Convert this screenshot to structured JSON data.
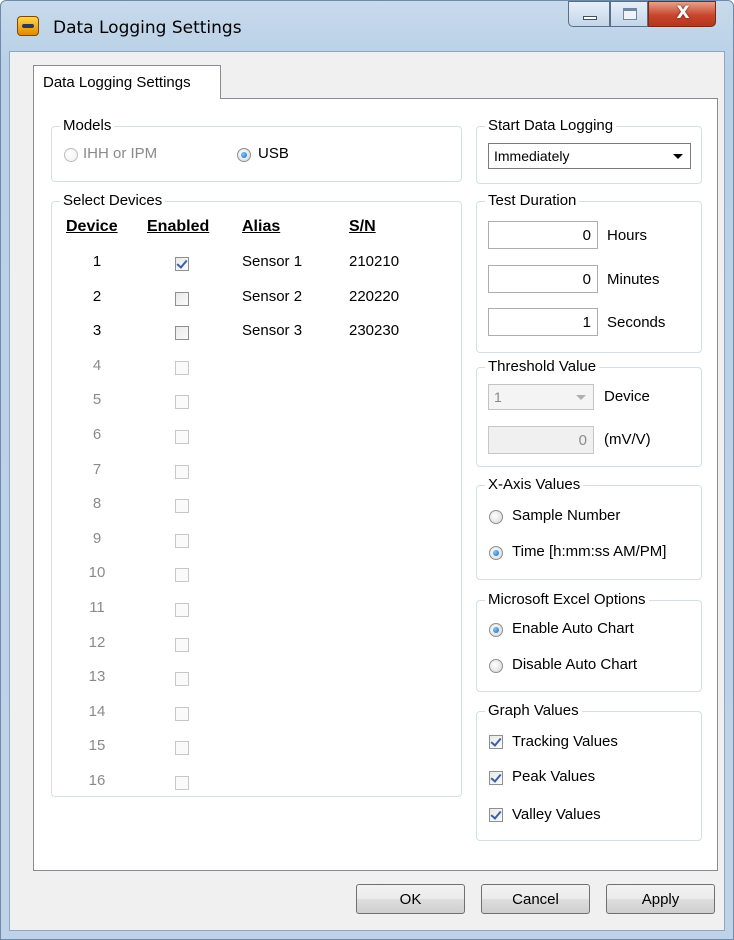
{
  "window": {
    "title": "Data Logging Settings",
    "close_glyph": "X",
    "icons": {
      "app": "usb-app-icon",
      "min": "minimize-icon",
      "max": "maximize-icon",
      "close": "close-icon"
    }
  },
  "tab": {
    "label": "Data Logging Settings"
  },
  "models": {
    "label": "Models",
    "options": [
      {
        "label": "IHH or IPM",
        "checked": false,
        "enabled": false
      },
      {
        "label": "USB",
        "checked": true,
        "enabled": true
      }
    ]
  },
  "devices": {
    "label": "Select Devices",
    "headers": {
      "device": "Device",
      "enabled": "Enabled",
      "alias": "Alias",
      "sn": "S/N"
    },
    "rows": [
      {
        "device": "1",
        "enabled": true,
        "active": true,
        "alias": "Sensor 1",
        "sn": "210210"
      },
      {
        "device": "2",
        "enabled": false,
        "active": true,
        "alias": "Sensor 2",
        "sn": "220220"
      },
      {
        "device": "3",
        "enabled": false,
        "active": true,
        "alias": "Sensor 3",
        "sn": "230230"
      },
      {
        "device": "4",
        "enabled": false,
        "active": false,
        "alias": "",
        "sn": ""
      },
      {
        "device": "5",
        "enabled": false,
        "active": false,
        "alias": "",
        "sn": ""
      },
      {
        "device": "6",
        "enabled": false,
        "active": false,
        "alias": "",
        "sn": ""
      },
      {
        "device": "7",
        "enabled": false,
        "active": false,
        "alias": "",
        "sn": ""
      },
      {
        "device": "8",
        "enabled": false,
        "active": false,
        "alias": "",
        "sn": ""
      },
      {
        "device": "9",
        "enabled": false,
        "active": false,
        "alias": "",
        "sn": ""
      },
      {
        "device": "10",
        "enabled": false,
        "active": false,
        "alias": "",
        "sn": ""
      },
      {
        "device": "11",
        "enabled": false,
        "active": false,
        "alias": "",
        "sn": ""
      },
      {
        "device": "12",
        "enabled": false,
        "active": false,
        "alias": "",
        "sn": ""
      },
      {
        "device": "13",
        "enabled": false,
        "active": false,
        "alias": "",
        "sn": ""
      },
      {
        "device": "14",
        "enabled": false,
        "active": false,
        "alias": "",
        "sn": ""
      },
      {
        "device": "15",
        "enabled": false,
        "active": false,
        "alias": "",
        "sn": ""
      },
      {
        "device": "16",
        "enabled": false,
        "active": false,
        "alias": "",
        "sn": ""
      }
    ]
  },
  "start_logging": {
    "label": "Start Data Logging",
    "value": "Immediately"
  },
  "test_duration": {
    "label": "Test Duration",
    "hours": {
      "value": "0",
      "unit": "Hours"
    },
    "minutes": {
      "value": "0",
      "unit": "Minutes"
    },
    "seconds": {
      "value": "1",
      "unit": "Seconds"
    }
  },
  "threshold": {
    "label": "Threshold Value",
    "device_value": "1",
    "device_label": "Device",
    "value": "0",
    "unit": "(mV/V)"
  },
  "xaxis": {
    "label": "X-Axis Values",
    "options": [
      {
        "label": "Sample Number",
        "checked": false
      },
      {
        "label": "Time [h:mm:ss AM/PM]",
        "checked": true
      }
    ]
  },
  "excel": {
    "label": "Microsoft Excel Options",
    "options": [
      {
        "label": "Enable Auto Chart",
        "checked": true
      },
      {
        "label": "Disable Auto Chart",
        "checked": false
      }
    ]
  },
  "graph": {
    "label": "Graph Values",
    "options": [
      {
        "label": "Tracking Values",
        "checked": true
      },
      {
        "label": "Peak Values",
        "checked": true
      },
      {
        "label": "Valley Values",
        "checked": true
      }
    ]
  },
  "buttons": {
    "ok": "OK",
    "cancel": "Cancel",
    "apply": "Apply"
  }
}
